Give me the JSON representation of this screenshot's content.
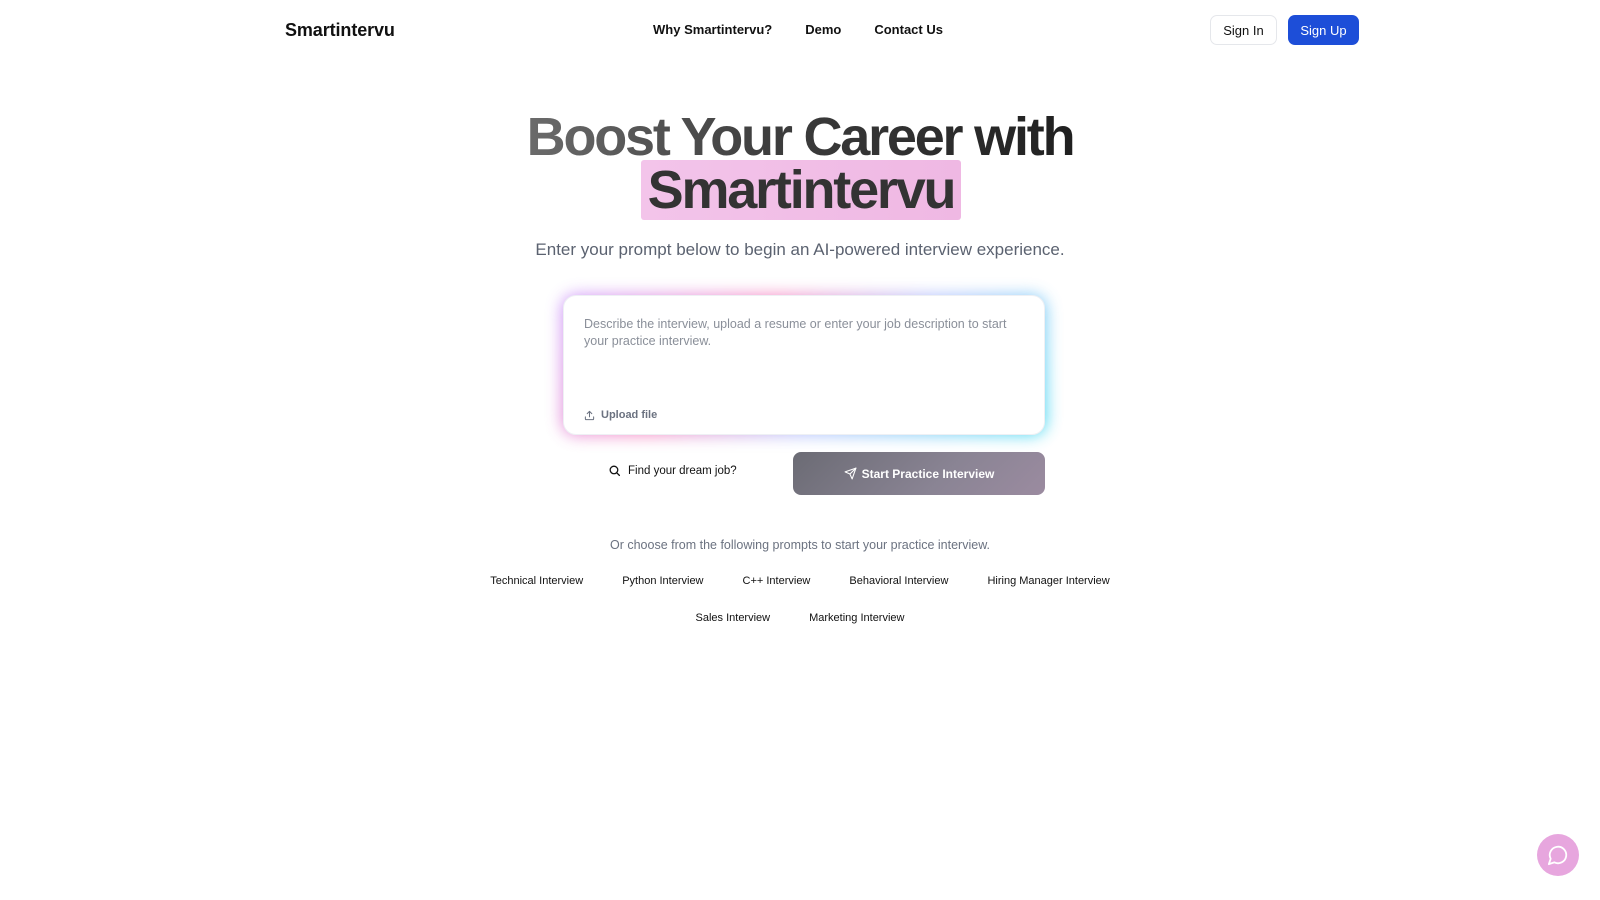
{
  "header": {
    "brand": "Smartintervu",
    "nav": [
      {
        "label": "Why Smartintervu?"
      },
      {
        "label": "Demo"
      },
      {
        "label": "Contact Us"
      }
    ],
    "sign_in": "Sign In",
    "sign_up": "Sign Up"
  },
  "hero": {
    "title_line1": "Boost Your Career with",
    "title_highlight": "Smartintervu",
    "subtitle": "Enter your prompt below to begin an AI-powered interview experience."
  },
  "prompt": {
    "placeholder": "Describe the interview, upload a resume or enter your job description to start your practice interview.",
    "upload_label": "Upload file"
  },
  "actions": {
    "find_job": "Find your dream job?",
    "start": "Start Practice Interview"
  },
  "prompts": {
    "intro": "Or choose from the following prompts to start your practice interview.",
    "row1": [
      {
        "label": "Technical Interview"
      },
      {
        "label": "Python Interview"
      },
      {
        "label": "C++ Interview"
      },
      {
        "label": "Behavioral Interview"
      },
      {
        "label": "Hiring Manager Interview"
      }
    ],
    "row2": [
      {
        "label": "Sales Interview"
      },
      {
        "label": "Marketing Interview"
      }
    ]
  },
  "colors": {
    "primary_button": "#1d4ed8",
    "highlight": "#f0bde6",
    "chat_bubble": "#e7a6de"
  },
  "icons": {
    "upload": "upload-icon",
    "search": "search-icon",
    "send": "send-icon",
    "chat": "chat-icon"
  }
}
